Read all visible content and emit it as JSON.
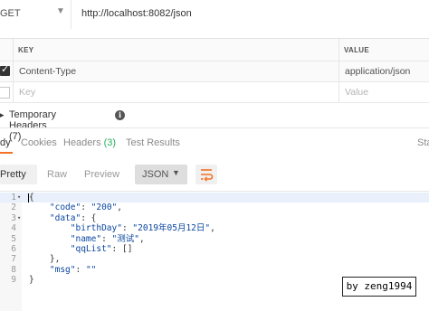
{
  "request": {
    "method": "GET",
    "url": "http://localhost:8082/json"
  },
  "headers_table": {
    "columns": [
      "KEY",
      "VALUE"
    ],
    "rows": [
      {
        "key": "Content-Type",
        "value": "application/json",
        "checked": true
      }
    ],
    "new_row": {
      "key_placeholder": "Key",
      "value_placeholder": "Value"
    }
  },
  "temporary_headers": {
    "label": "Temporary Headers (7)"
  },
  "response_tabs": {
    "body": "dy",
    "cookies": "Cookies",
    "headers": "Headers",
    "headers_count": "(3)",
    "tests": "Test Results",
    "status_partial": "Sta"
  },
  "body_toolbar": {
    "pretty": "Pretty",
    "raw": "Raw",
    "preview": "Preview",
    "format": "JSON"
  },
  "code_lines": [
    {
      "num": "1",
      "fold": "▾",
      "text": "{"
    },
    {
      "num": "2",
      "fold": "",
      "text": "    \"code\": \"200\","
    },
    {
      "num": "3",
      "fold": "▾",
      "text": "    \"data\": {"
    },
    {
      "num": "4",
      "fold": "",
      "text": "        \"birthDay\": \"2019年05月12日\","
    },
    {
      "num": "5",
      "fold": "",
      "text": "        \"name\": \"测试\","
    },
    {
      "num": "6",
      "fold": "",
      "text": "        \"qqList\": []"
    },
    {
      "num": "7",
      "fold": "",
      "text": "    },"
    },
    {
      "num": "8",
      "fold": "",
      "text": "    \"msg\": \"\""
    },
    {
      "num": "9",
      "fold": "",
      "text": "}"
    }
  ],
  "watermark": "by zeng1994",
  "colors": {
    "accent": "#f47023",
    "count_green": "#27ae60",
    "json_key": "#0a46a0"
  }
}
